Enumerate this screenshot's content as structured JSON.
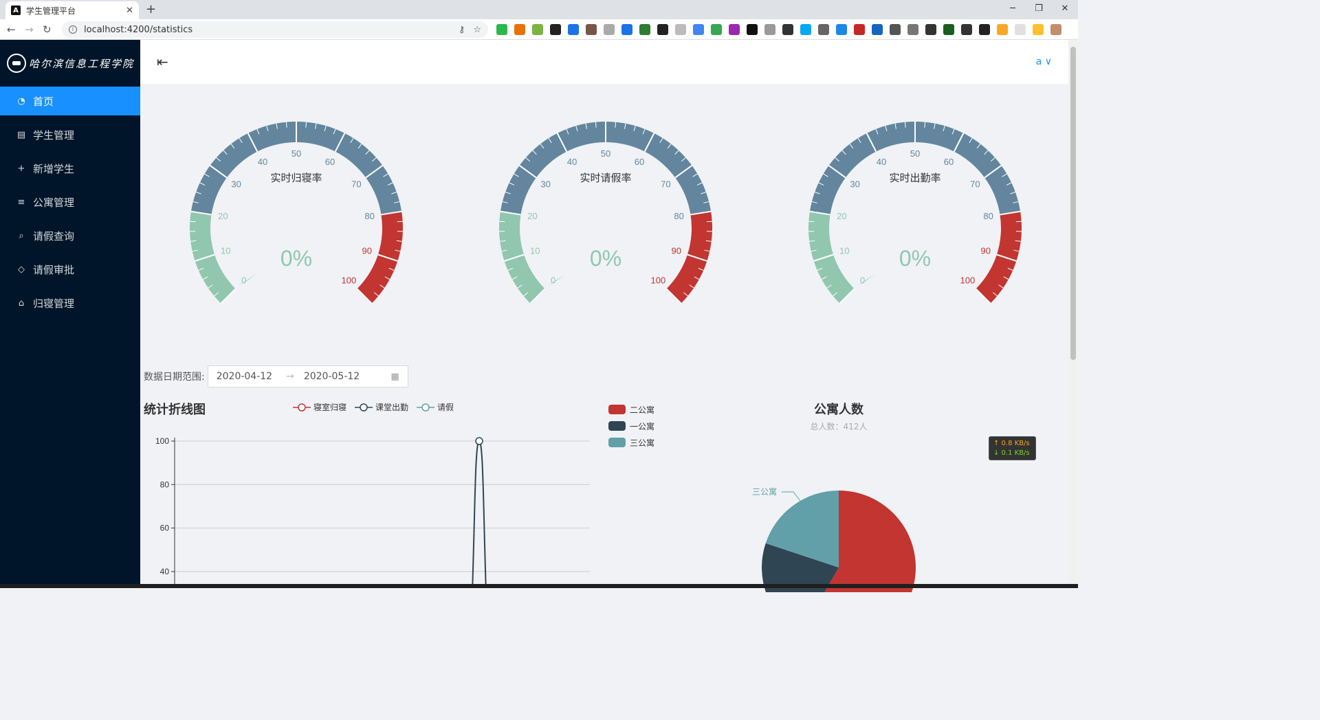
{
  "browser": {
    "tab_title": "学生管理平台",
    "tab_icon": "angular-icon",
    "url": "localhost:4200/statistics"
  },
  "app": {
    "logo_text": "哈尔滨信息工程学院",
    "user": "a ∨",
    "menu": [
      {
        "label": "首页",
        "icon": "pie-chart-icon",
        "active": true
      },
      {
        "label": "学生管理",
        "icon": "profile-icon",
        "active": false
      },
      {
        "label": "新增学生",
        "icon": "plus-icon",
        "active": false
      },
      {
        "label": "公寓管理",
        "icon": "align-left-icon",
        "active": false
      },
      {
        "label": "请假查询",
        "icon": "search-icon",
        "active": false
      },
      {
        "label": "请假审批",
        "icon": "tag-icon",
        "active": false
      },
      {
        "label": "归寝管理",
        "icon": "home-icon",
        "active": false
      }
    ]
  },
  "gauges": [
    {
      "title": "实时归寝率",
      "value": 0,
      "display": "0%"
    },
    {
      "title": "实时请假率",
      "value": 0,
      "display": "0%"
    },
    {
      "title": "实时出勤率",
      "value": 0,
      "display": "0%"
    }
  ],
  "gauge_style": {
    "ticks": [
      "0",
      "10",
      "20",
      "30",
      "40",
      "50",
      "60",
      "70",
      "80",
      "90",
      "100"
    ],
    "colors": [
      "#91c7ae",
      "#63869e",
      "#c23531"
    ],
    "bands": [
      0.2,
      0.8,
      1.0
    ]
  },
  "filter": {
    "label": "数据日期范围:",
    "start": "2020-04-12",
    "end": "2020-05-12"
  },
  "line_chart": {
    "title": "统计折线图",
    "legend": [
      "寝室归寝",
      "课堂出勤",
      "请假"
    ],
    "colors": [
      "#c23531",
      "#2f4554",
      "#61a0a8"
    ]
  },
  "pie_chart": {
    "title": "公寓人数",
    "subtitle": "总人数：412人",
    "legend": [
      "二公寓",
      "一公寓",
      "三公寓"
    ],
    "colors": [
      "#c23531",
      "#2f4554",
      "#61a0a8"
    ],
    "visible_label": "三公寓"
  },
  "net_speed": {
    "up": "↑ 0.8 KB/s",
    "down": "↓ 0.1 KB/s"
  },
  "chart_data": [
    {
      "type": "line",
      "title": "统计折线图",
      "legend": [
        "寝室归寝",
        "课堂出勤",
        "请假"
      ],
      "yticks": [
        40,
        60,
        80,
        100
      ],
      "ylim_visible": [
        40,
        100
      ],
      "series": [
        {
          "name": "课堂出勤",
          "peak_value": 100
        }
      ]
    },
    {
      "type": "pie",
      "title": "公寓人数",
      "subtitle": "总人数：412人",
      "categories": [
        "二公寓",
        "一公寓",
        "三公寓"
      ],
      "values": [
        240,
        90,
        82
      ]
    }
  ]
}
